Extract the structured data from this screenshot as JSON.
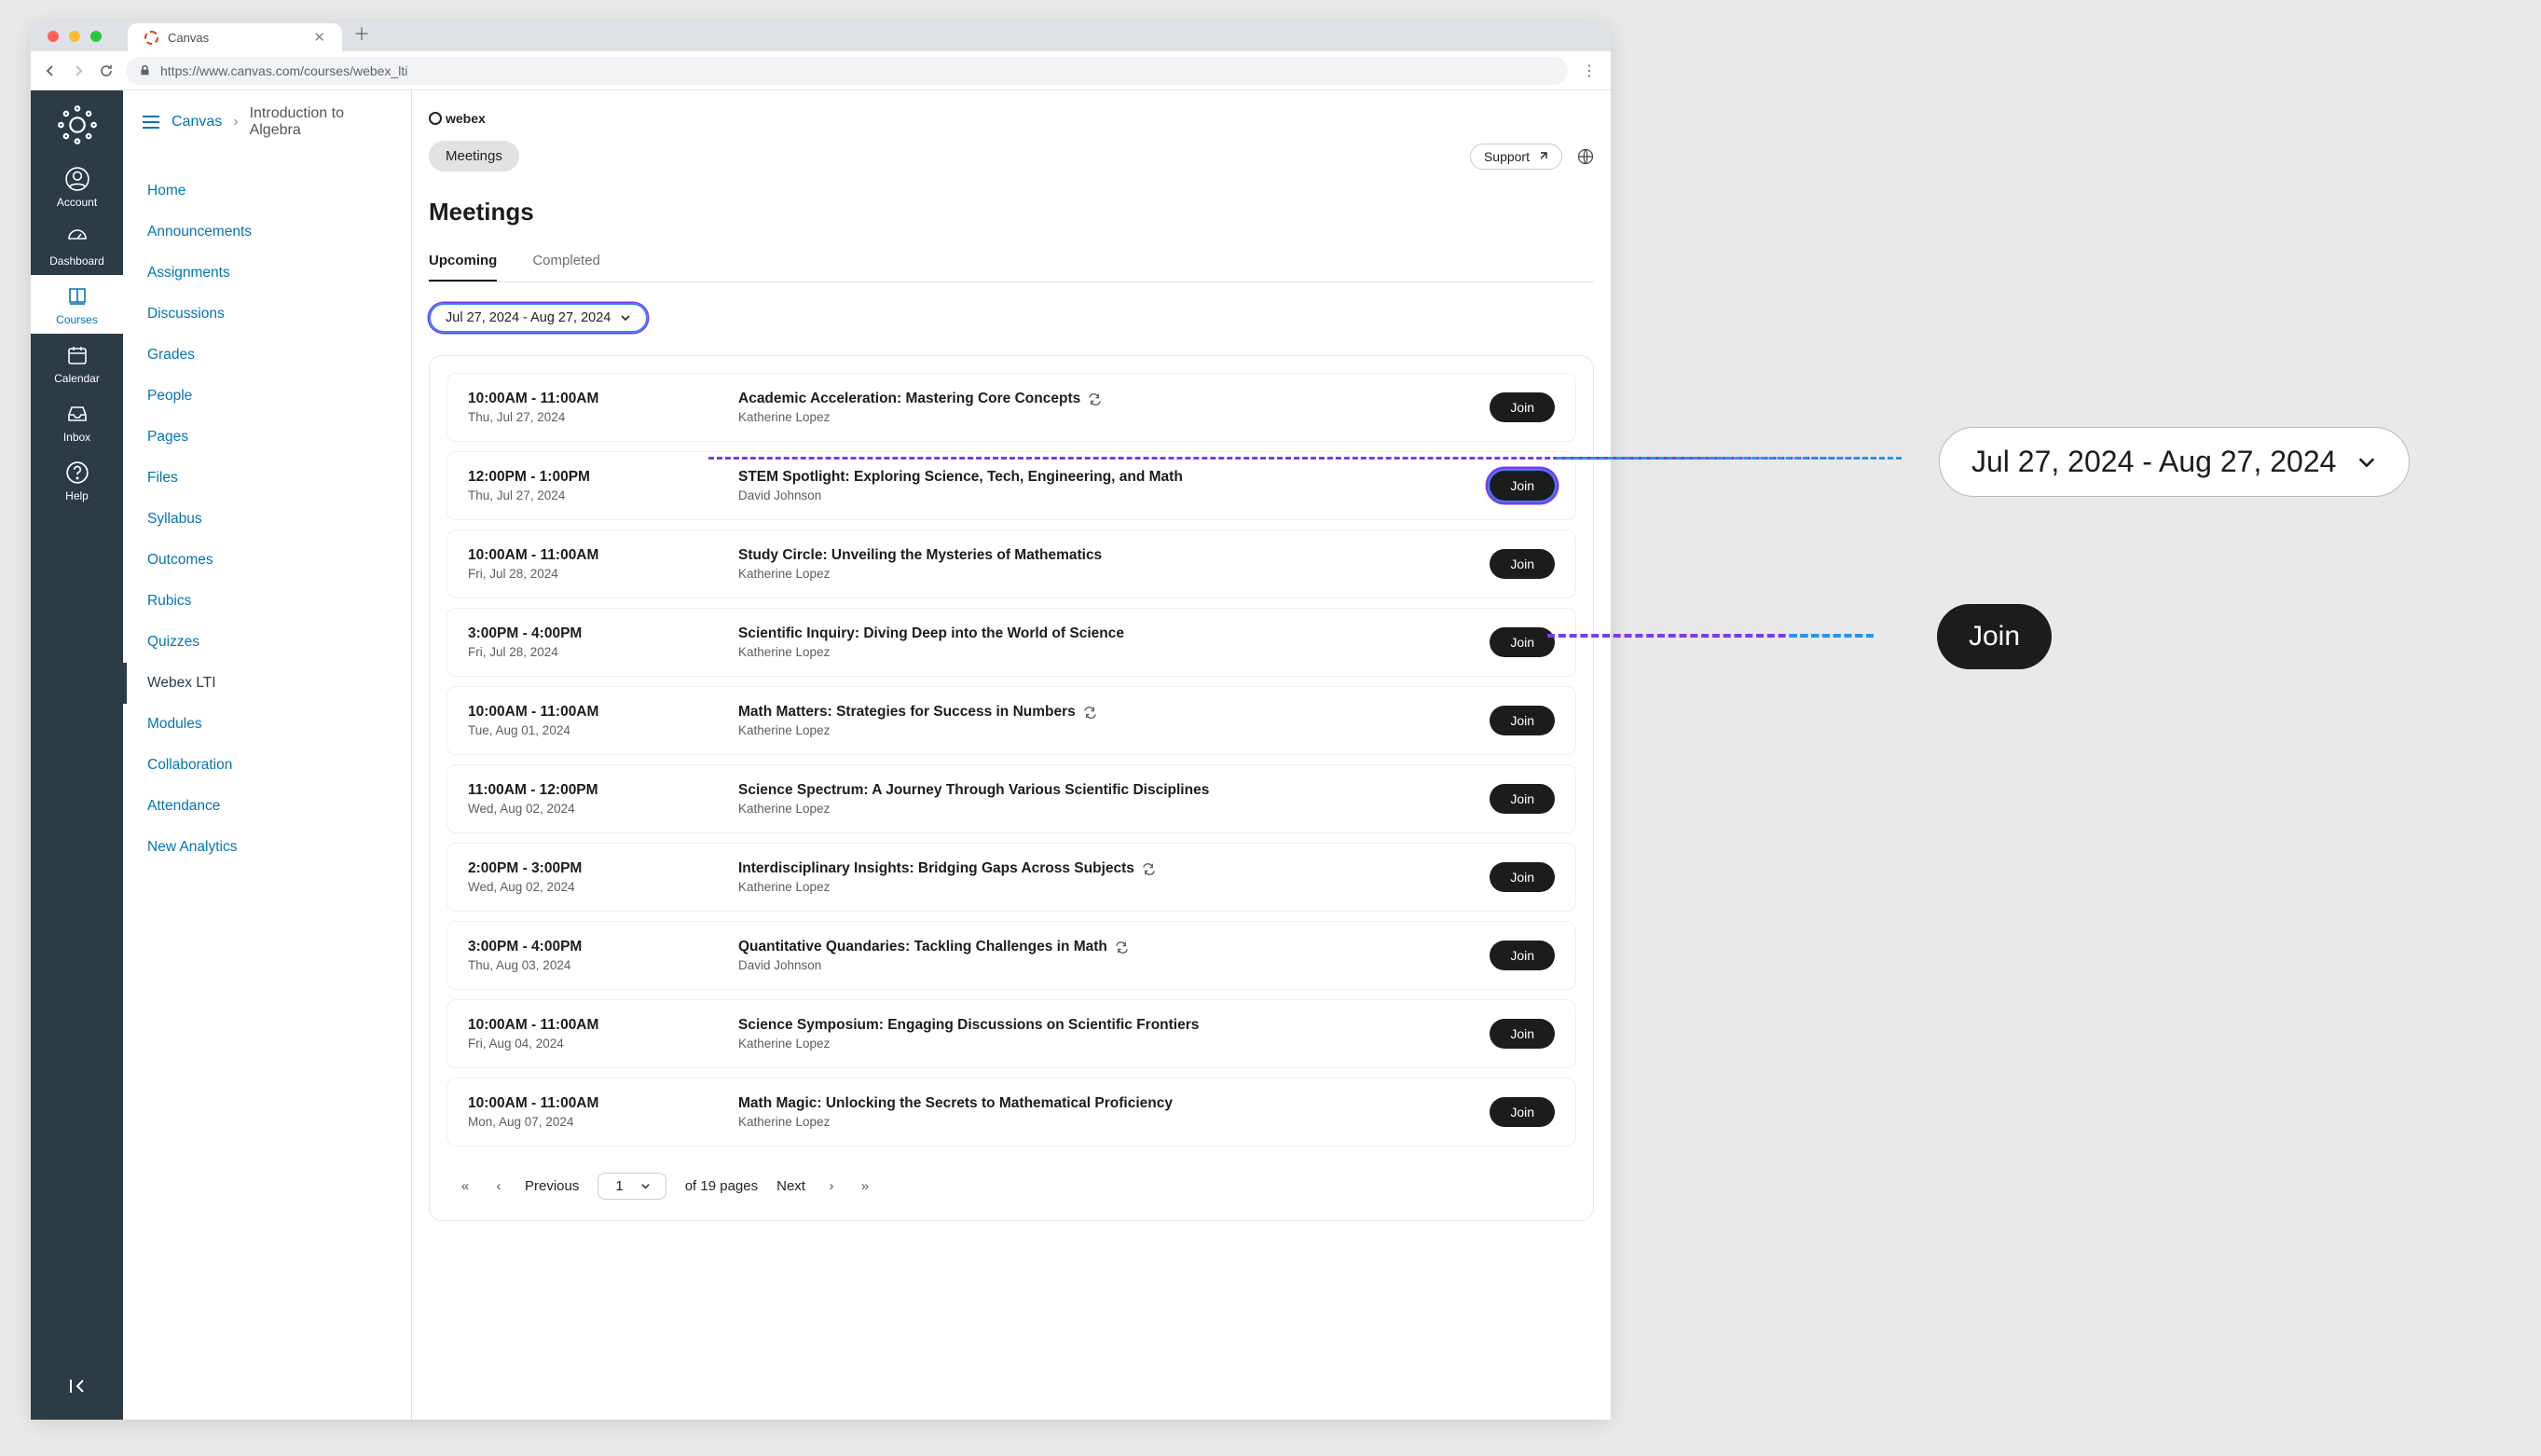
{
  "browser": {
    "tab_title": "Canvas",
    "url": "https://www.canvas.com/courses/webex_lti"
  },
  "breadcrumb": {
    "app": "Canvas",
    "course": "Introduction to Algebra"
  },
  "rail": {
    "account": "Account",
    "dashboard": "Dashboard",
    "courses": "Courses",
    "calendar": "Calendar",
    "inbox": "Inbox",
    "help": "Help"
  },
  "course_nav": {
    "home": "Home",
    "announcements": "Announcements",
    "assignments": "Assignments",
    "discussions": "Discussions",
    "grades": "Grades",
    "people": "People",
    "pages": "Pages",
    "files": "Files",
    "syllabus": "Syllabus",
    "outcomes": "Outcomes",
    "rubics": "Rubics",
    "quizzes": "Quizzes",
    "webex": "Webex LTI",
    "modules": "Modules",
    "collaboration": "Collaboration",
    "attendance": "Attendance",
    "analytics": "New Analytics"
  },
  "webex": {
    "logo": "webex",
    "meetings_pill": "Meetings",
    "support": "Support",
    "page_title": "Meetings",
    "tab_upcoming": "Upcoming",
    "tab_completed": "Completed",
    "date_range": "Jul 27, 2024 - Aug 27, 2024",
    "join_label": "Join"
  },
  "meetings": [
    {
      "time": "10:00AM - 11:00AM",
      "date": "Thu, Jul 27, 2024",
      "title": "Academic Acceleration: Mastering Core Concepts",
      "host": "Katherine Lopez",
      "recurring": true
    },
    {
      "time": "12:00PM - 1:00PM",
      "date": "Thu, Jul 27, 2024",
      "title": "STEM Spotlight: Exploring Science, Tech, Engineering, and Math",
      "host": "David Johnson",
      "recurring": false
    },
    {
      "time": "10:00AM - 11:00AM",
      "date": "Fri, Jul 28, 2024",
      "title": "Study Circle: Unveiling the Mysteries of Mathematics",
      "host": "Katherine Lopez",
      "recurring": false
    },
    {
      "time": "3:00PM - 4:00PM",
      "date": "Fri, Jul 28, 2024",
      "title": "Scientific Inquiry: Diving Deep into the World of Science",
      "host": "Katherine Lopez",
      "recurring": false
    },
    {
      "time": "10:00AM - 11:00AM",
      "date": "Tue, Aug 01, 2024",
      "title": "Math Matters: Strategies for Success in Numbers",
      "host": "Katherine Lopez",
      "recurring": true
    },
    {
      "time": "11:00AM - 12:00PM",
      "date": "Wed, Aug 02, 2024",
      "title": "Science Spectrum: A Journey Through Various Scientific Disciplines",
      "host": "Katherine Lopez",
      "recurring": false
    },
    {
      "time": "2:00PM - 3:00PM",
      "date": "Wed, Aug 02, 2024",
      "title": "Interdisciplinary Insights: Bridging Gaps Across Subjects",
      "host": "Katherine Lopez",
      "recurring": true
    },
    {
      "time": "3:00PM - 4:00PM",
      "date": "Thu, Aug 03, 2024",
      "title": "Quantitative Quandaries: Tackling Challenges in Math",
      "host": "David Johnson",
      "recurring": true
    },
    {
      "time": "10:00AM - 11:00AM",
      "date": "Fri, Aug 04, 2024",
      "title": "Science Symposium: Engaging Discussions on Scientific Frontiers",
      "host": "Katherine Lopez",
      "recurring": false
    },
    {
      "time": "10:00AM - 11:00AM",
      "date": "Mon, Aug 07, 2024",
      "title": "Math Magic: Unlocking the Secrets to Mathematical Proficiency",
      "host": "Katherine Lopez",
      "recurring": false
    }
  ],
  "pagination": {
    "previous": "Previous",
    "next": "Next",
    "page": "1",
    "total_text": "of 19 pages"
  },
  "callout": {
    "date_range": "Jul 27, 2024 - Aug 27, 2024",
    "join": "Join"
  }
}
